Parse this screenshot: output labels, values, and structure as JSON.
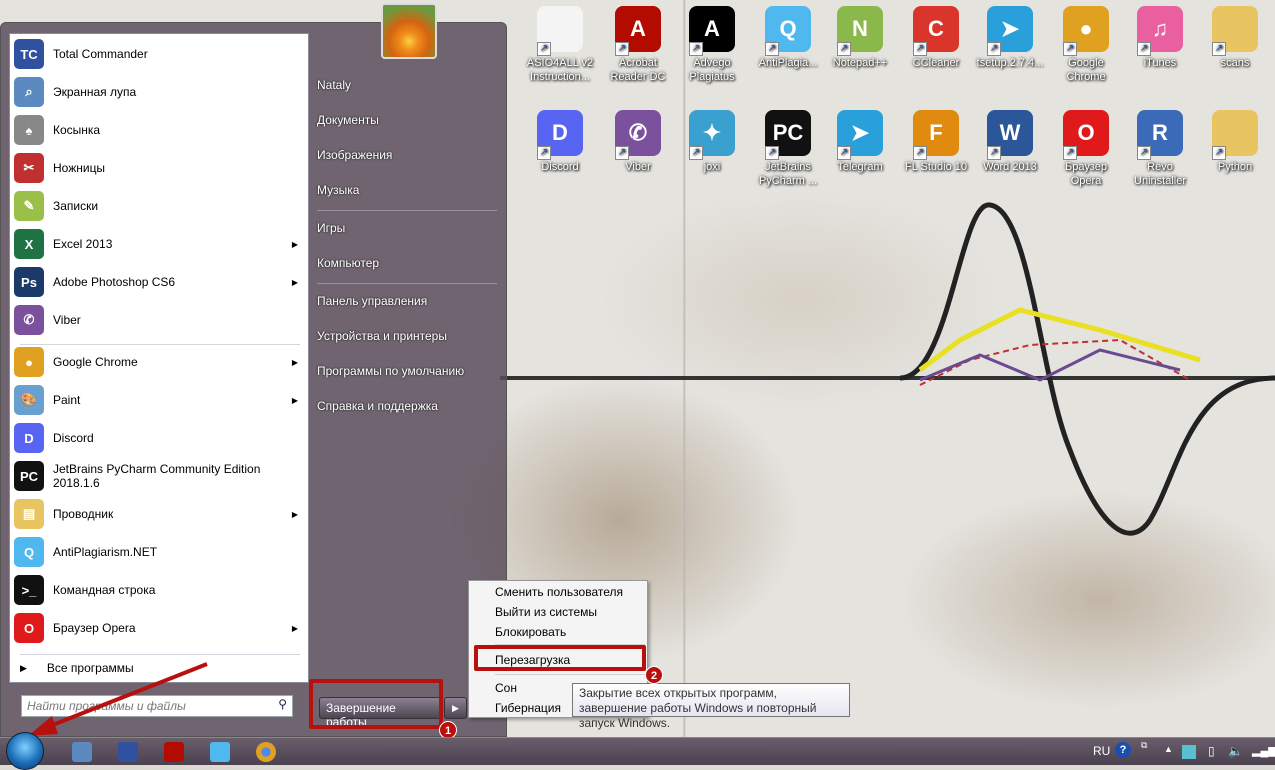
{
  "desktop": {
    "icons": [
      {
        "label": "ASIO4ALL v2 Instruction...",
        "glyph": "",
        "color": "#f4f4f4"
      },
      {
        "label": "Acrobat Reader DC",
        "glyph": "A",
        "color": "#b30b00"
      },
      {
        "label": "Advego Plagiatus",
        "glyph": "A",
        "color": "#000000"
      },
      {
        "label": "AntiPlagia...",
        "glyph": "Q",
        "color": "#4fb8ef"
      },
      {
        "label": "Notepad++",
        "glyph": "N",
        "color": "#8ab84a"
      },
      {
        "label": "CCleaner",
        "glyph": "C",
        "color": "#d9352a"
      },
      {
        "label": "tsetup.2.7.4...",
        "glyph": "➤",
        "color": "#2aa0da"
      },
      {
        "label": "Google Chrome",
        "glyph": "●",
        "color": "#e0a020"
      },
      {
        "label": "iTunes",
        "glyph": "♫",
        "color": "#e95fa0"
      },
      {
        "label": "scans",
        "glyph": "",
        "color": "#e8c560"
      },
      {
        "label": "Discord",
        "glyph": "D",
        "color": "#5865f2"
      },
      {
        "label": "Viber",
        "glyph": "✆",
        "color": "#7b519d"
      },
      {
        "label": "joxi",
        "glyph": "✦",
        "color": "#3aa0d0"
      },
      {
        "label": "JetBrains PyCharm ...",
        "glyph": "PC",
        "color": "#111111"
      },
      {
        "label": "Telegram",
        "glyph": "➤",
        "color": "#2aa0da"
      },
      {
        "label": "FL Studio 10",
        "glyph": "F",
        "color": "#e08a10"
      },
      {
        "label": "Word 2013",
        "glyph": "W",
        "color": "#2b579a"
      },
      {
        "label": "Браузер Opera",
        "glyph": "O",
        "color": "#e01a1a"
      },
      {
        "label": "Revo Uninstaller",
        "glyph": "R",
        "color": "#3a6ab8"
      },
      {
        "label": "Python",
        "glyph": "",
        "color": "#e8c560"
      }
    ]
  },
  "start_menu": {
    "programs": [
      {
        "label": "Total Commander",
        "glyph": "TC",
        "color": "#3050a0",
        "arrow": false
      },
      {
        "label": "Экранная лупа",
        "glyph": "⌕",
        "color": "#5a8ac0",
        "arrow": false
      },
      {
        "label": "Косынка",
        "glyph": "♠",
        "color": "#888888",
        "arrow": false
      },
      {
        "label": "Ножницы",
        "glyph": "✂",
        "color": "#c03030",
        "arrow": false
      },
      {
        "label": "Записки",
        "glyph": "✎",
        "color": "#9ac04a",
        "arrow": false
      },
      {
        "label": "Excel 2013",
        "glyph": "X",
        "color": "#1f7244",
        "arrow": true
      },
      {
        "label": "Adobe Photoshop CS6",
        "glyph": "Ps",
        "color": "#1b3a6a",
        "arrow": true
      },
      {
        "label": "Viber",
        "glyph": "✆",
        "color": "#7b519d",
        "arrow": false
      },
      {
        "label": "Google Chrome",
        "glyph": "●",
        "color": "#e0a020",
        "arrow": true
      },
      {
        "label": "Paint",
        "glyph": "🎨",
        "color": "#6aa0d0",
        "arrow": true
      },
      {
        "label": "Discord",
        "glyph": "D",
        "color": "#5865f2",
        "arrow": false
      },
      {
        "label": "JetBrains PyCharm Community Edition 2018.1.6",
        "glyph": "PC",
        "color": "#111111",
        "arrow": false
      },
      {
        "label": "Проводник",
        "glyph": "▤",
        "color": "#e8c560",
        "arrow": true
      },
      {
        "label": "AntiPlagiarism.NET",
        "glyph": "Q",
        "color": "#4fb8ef",
        "arrow": false
      },
      {
        "label": "Командная строка",
        "glyph": ">_",
        "color": "#111111",
        "arrow": false
      },
      {
        "label": "Браузер Opera",
        "glyph": "O",
        "color": "#e01a1a",
        "arrow": true
      }
    ],
    "all_programs": "Все программы",
    "search_placeholder": "Найти программы и файлы",
    "right_items": [
      "Nataly",
      "Документы",
      "Изображения",
      "Музыка",
      "Игры",
      "Компьютер",
      "Панель управления",
      "Устройства и принтеры",
      "Программы по умолчанию",
      "Справка и поддержка"
    ],
    "shutdown_label": "Завершение работы"
  },
  "shutdown_menu": {
    "items": [
      "Сменить пользователя",
      "Выйти из системы",
      "Блокировать",
      "Перезагрузка",
      "Сон",
      "Гибернация"
    ]
  },
  "tooltip": "Закрытие всех открытых программ, завершение работы Windows и повторный запуск Windows.",
  "annotations": {
    "badge1": "1",
    "badge2": "2",
    "color": "#b8100c"
  },
  "taskbar": {
    "language": "RU",
    "help": "?"
  }
}
